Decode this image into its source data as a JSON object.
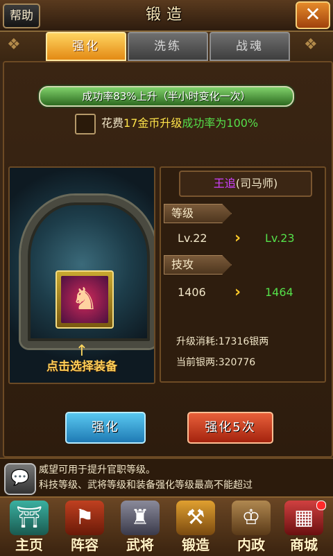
{
  "header": {
    "help_label": "帮助",
    "title": "锻造",
    "close_label": "✕"
  },
  "tabs": [
    {
      "label": "强化",
      "active": true
    },
    {
      "label": "洗练",
      "active": false
    },
    {
      "label": "战魂",
      "active": false
    }
  ],
  "success": {
    "bar_text": "成功率83%上升（半小时变化一次）",
    "rate_percent": 83
  },
  "cost_option": {
    "part1": "花费",
    "gold_text": "17金币升级",
    "rate_text": "成功率为100%"
  },
  "equipment": {
    "hint": "点击选择装备",
    "arrow": "↑"
  },
  "general": {
    "name": "王追",
    "role": "(司马师)"
  },
  "stats": {
    "level_label": "等级",
    "level_from": "Lv.22",
    "level_to": "Lv.23",
    "skill_label": "技攻",
    "skill_from": "1406",
    "skill_to": "1464",
    "upgrade_cost": "升级消耗:17316银两",
    "current_silver": "当前银两:320776"
  },
  "buttons": {
    "enhance": "强化",
    "enhance5": "强化5次"
  },
  "tips": {
    "line1": "威望可用于提升官职等级。",
    "line2": "科技等级、武将等级和装备强化等级最高不能超过"
  },
  "nav": [
    {
      "label": "主页",
      "icon": "home-icon"
    },
    {
      "label": "阵容",
      "icon": "formation-icon"
    },
    {
      "label": "武将",
      "icon": "general-icon"
    },
    {
      "label": "锻造",
      "icon": "forge-icon"
    },
    {
      "label": "内政",
      "icon": "internal-affairs-icon"
    },
    {
      "label": "商城",
      "icon": "shop-icon"
    }
  ],
  "colors": {
    "active_tab": "#f0a02a",
    "success_green": "#55e04a",
    "gold": "#ffe44a",
    "name_purple": "#d040ff"
  }
}
